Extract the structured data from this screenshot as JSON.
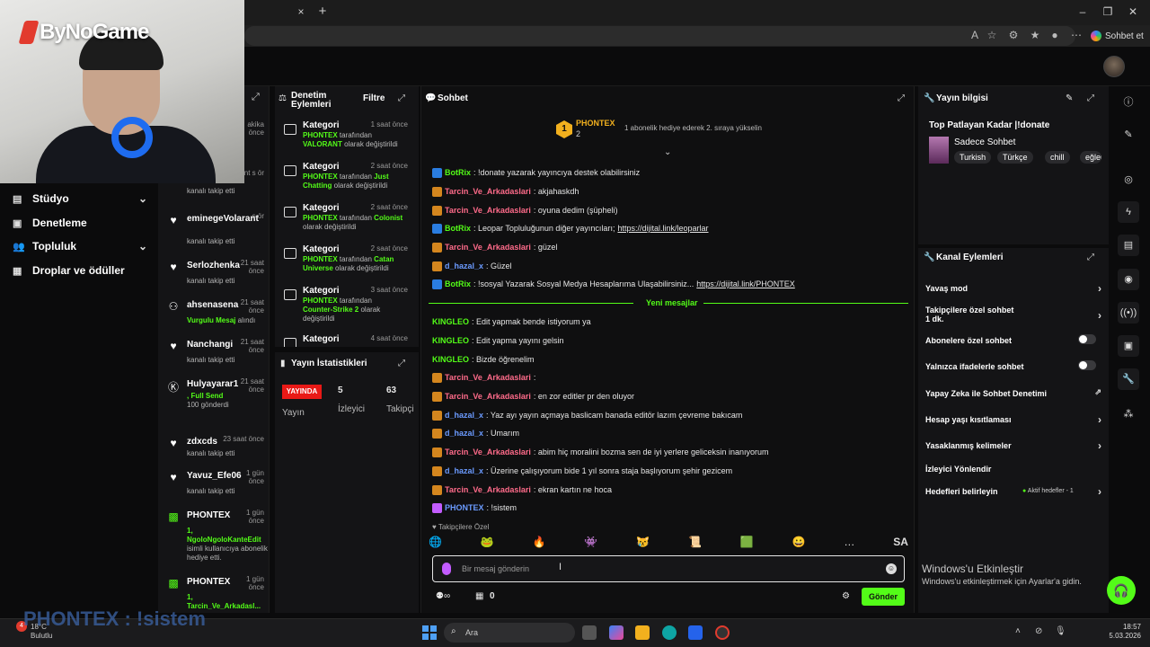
{
  "browser": {
    "close_tab": "×",
    "new_tab": "+",
    "copilot_label": "Sohbet et"
  },
  "brand": {
    "name": "ByNoGame"
  },
  "nav": {
    "items": [
      {
        "label": "Stüdyo",
        "icon": "studio-icon",
        "chevron": true
      },
      {
        "label": "Denetleme",
        "icon": "moderation-icon",
        "chevron": false
      },
      {
        "label": "Topluluk",
        "icon": "community-icon",
        "chevron": true
      },
      {
        "label": "Droplar ve ödüller",
        "icon": "drops-icon",
        "chevron": false
      }
    ]
  },
  "activity": {
    "items": [
      {
        "name": "",
        "time": "akika önce",
        "desc": ""
      },
      {
        "name": "",
        "time": "ant s ör",
        "desc": "kanalı takip etti"
      },
      {
        "name": "eminegeVolarant",
        "time": "s ör",
        "desc": "kanalı takip etti",
        "icon": "heart-icon"
      },
      {
        "name": "Serlozhenka",
        "time": "21 saat önce",
        "desc": "kanalı takip etti",
        "icon": "heart-icon"
      },
      {
        "name": "ahsenasena",
        "time": "21 saat önce",
        "desc_green": "Vurgulu Mesaj",
        "desc": "alındı",
        "icon": "users-icon"
      },
      {
        "name": "Nanchangi",
        "time": "21 saat önce",
        "desc": "kanalı takip etti",
        "icon": "heart-icon"
      },
      {
        "name": "Hulyayarar1",
        "time": "21 saat önce",
        "desc_green": ", Full Send",
        "desc": "100 gönderdi",
        "icon": "kick-icon"
      },
      {
        "name": "zdxcds",
        "time": "23 saat önce",
        "desc": "kanalı takip etti",
        "icon": "heart-icon"
      },
      {
        "name": "Yavuz_Efe06",
        "time": "1 gün önce",
        "desc": "kanalı takip etti",
        "icon": "heart-icon"
      },
      {
        "name": "PHONTEX",
        "time": "1 gün önce",
        "desc_green": "1, NgoloNgoloKanteEdit",
        "desc": "isimli kullanıcıya abonelik hediye etti.",
        "icon": "gift-icon"
      },
      {
        "name": "PHONTEX",
        "time": "1 gün önce",
        "desc_green": "1, Tarcin_Ve_Arkadasl...",
        "desc": "",
        "icon": "gift-icon"
      }
    ]
  },
  "denetim": {
    "title": "Denetim Eylemleri",
    "filter": "Filtre",
    "logs": [
      {
        "cat": "Kategori",
        "time": "1 saat önce",
        "by": "PHONTEX",
        "mid": "tarafından",
        "val": "VALORANT",
        "tail": "olarak değiştirildi"
      },
      {
        "cat": "Kategori",
        "time": "2 saat önce",
        "by": "PHONTEX",
        "mid": "tarafından",
        "val": "Just Chatting",
        "tail": "olarak değiştirildi"
      },
      {
        "cat": "Kategori",
        "time": "2 saat önce",
        "by": "PHONTEX",
        "mid": "tarafından",
        "val": "Colonist",
        "tail": "olarak değiştirildi"
      },
      {
        "cat": "Kategori",
        "time": "2 saat önce",
        "by": "PHONTEX",
        "mid": "tarafından",
        "val": "Catan Universe",
        "tail": "olarak değiştirildi"
      },
      {
        "cat": "Kategori",
        "time": "3 saat önce",
        "by": "PHONTEX",
        "mid": "tarafından",
        "val": "Counter-Strike 2",
        "tail": "olarak değiştirildi"
      },
      {
        "cat": "Kategori",
        "time": "4 saat önce",
        "by": "",
        "mid": "",
        "val": "",
        "tail": ""
      }
    ]
  },
  "stats": {
    "title": "Yayın İstatistikleri",
    "live": "YAYINDA",
    "viewers_value": "5",
    "followers_value": "63",
    "col1": "Yayın",
    "col2": "İzleyici",
    "col3": "Takipçi"
  },
  "chat": {
    "title": "Sohbet",
    "pinned": {
      "name": "PHONTEX",
      "rank": "1",
      "count": "2",
      "sub": "1 abonelik hediye ederek 2. sıraya yükselin"
    },
    "messages": [
      {
        "user": "BotRix",
        "text": "!donate yazarak yayıncıya destek olabilirsiniz",
        "color": "#53fc18",
        "bot": true
      },
      {
        "user": "Tarcin_Ve_Arkadaslari",
        "text": "akjahaskdh",
        "color": "#ff6b8a"
      },
      {
        "user": "Tarcin_Ve_Arkadaslari",
        "text": "oyuna dedim (şüpheli)",
        "color": "#ff6b8a"
      },
      {
        "user": "BotRix",
        "text": "Leopar Topluluğunun diğer yayıncıları;",
        "link": "https://dijital.link/leoparlar",
        "color": "#53fc18",
        "bot": true
      },
      {
        "user": "Tarcin_Ve_Arkadaslari",
        "text": "güzel",
        "color": "#ff6b8a"
      },
      {
        "user": "d_hazal_x",
        "text": "Güzel",
        "color": "#6b9bff"
      },
      {
        "user": "BotRix",
        "text": "!sosyal Yazarak Sosyal Medya Hesaplarıma Ulaşabilirsiniz...",
        "link": "https://dijital.link/PHONTEX",
        "color": "#53fc18",
        "bot": true
      },
      {
        "user": "KINGLEO",
        "text": "Edit yapmak bende istiyorum ya",
        "color": "#53fc18"
      },
      {
        "user": "KINGLEO",
        "text": "Edit yapma yayını gelsin",
        "color": "#53fc18"
      },
      {
        "user": "KINGLEO",
        "text": "Bizde öğrenelim",
        "color": "#53fc18"
      },
      {
        "user": "Tarcin_Ve_Arkadaslari",
        "text": "",
        "color": "#ff6b8a"
      },
      {
        "user": "Tarcin_Ve_Arkadaslari",
        "text": "en zor editler pr den oluyor",
        "color": "#ff6b8a"
      },
      {
        "user": "d_hazal_x",
        "text": "Yaz ayı yayın açmaya baslicam banada editör lazım çevreme bakıcam",
        "color": "#6b9bff"
      },
      {
        "user": "d_hazal_x",
        "text": "Umarım",
        "color": "#6b9bff"
      },
      {
        "user": "Tarcin_Ve_Arkadaslari",
        "text": "abim hiç moralini bozma sen de iyi yerlere geliceksin inanıyorum",
        "color": "#ff6b8a"
      },
      {
        "user": "d_hazal_x",
        "text": "Üzerine çalışıyorum bide 1 yıl sonra staja başlıyorum şehir gezicem",
        "color": "#6b9bff"
      },
      {
        "user": "Tarcin_Ve_Arkadaslari",
        "text": "ekran kartın ne hoca",
        "color": "#ff6b8a"
      },
      {
        "user": "PHONTEX",
        "text": "!sistem",
        "color": "#6b9bff"
      }
    ],
    "new_messages": "Yeni mesajlar",
    "followers_only": "Takipçilere Özel",
    "placeholder": "Bir mesaj gönderin",
    "send": "Gönder",
    "footer_count": "0"
  },
  "info": {
    "title": "Yayın bilgisi",
    "stream_title": "Top Patlayan Kadar |!donate",
    "category": "Sadece Sohbet",
    "tags": [
      "Turkish",
      "Türkçe",
      "chill",
      "eğlen"
    ]
  },
  "channel": {
    "title": "Kanal Eylemleri",
    "rows": [
      {
        "label": "Yavaş mod",
        "kind": "chev"
      },
      {
        "label": "Takipçilere özel sohbet",
        "sub": "1 dk.",
        "kind": "chev"
      },
      {
        "label": "Abonelere özel sohbet",
        "kind": "toggle"
      },
      {
        "label": "Yalnızca ifadelerle sohbet",
        "kind": "toggle"
      },
      {
        "label": "Yapay Zeka ile Sohbet Denetimi",
        "kind": "ext"
      },
      {
        "label": "Hesap yaşı kısıtlaması",
        "kind": "chev"
      },
      {
        "label": "Yasaklanmış kelimeler",
        "kind": "chev"
      },
      {
        "label": "İzleyici Yönlendir",
        "kind": "none"
      },
      {
        "label": "Hedefleri belirleyin",
        "status": "Aktif hedefler - 1",
        "kind": "chev"
      }
    ]
  },
  "windows": {
    "activate_title": "Windows'u Etkinleştir",
    "activate_sub": "Windows'u etkinleştirmek için Ayarlar'a gidin.",
    "search": "Ara",
    "weather_temp": "18°C",
    "weather_desc": "Bulutlu",
    "time": "18:57",
    "date": "5.03.2026",
    "notif": "4"
  },
  "overlay": {
    "text": "PHONTEX : !sistem"
  },
  "colors": {
    "accent": "#53fc18",
    "live": "#e91916",
    "bg": "#0b0b0c",
    "panel": "#141416"
  }
}
